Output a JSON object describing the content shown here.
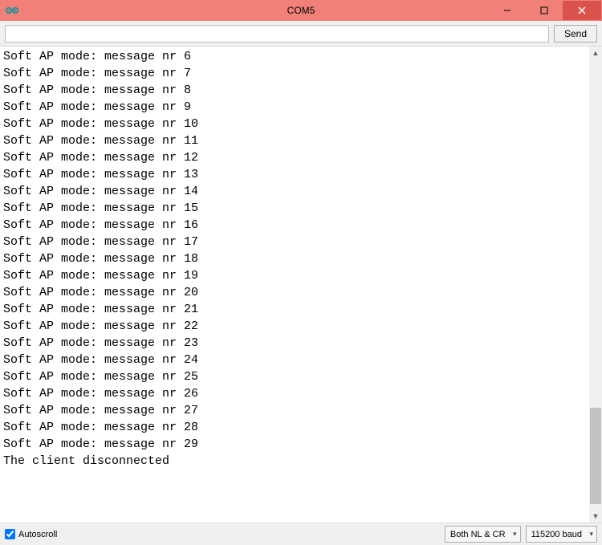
{
  "window": {
    "title": "COM5"
  },
  "toolbar": {
    "input_value": "",
    "send_label": "Send"
  },
  "console": {
    "lines": [
      "Soft AP mode: message nr 6",
      "Soft AP mode: message nr 7",
      "Soft AP mode: message nr 8",
      "Soft AP mode: message nr 9",
      "Soft AP mode: message nr 10",
      "Soft AP mode: message nr 11",
      "Soft AP mode: message nr 12",
      "Soft AP mode: message nr 13",
      "Soft AP mode: message nr 14",
      "Soft AP mode: message nr 15",
      "Soft AP mode: message nr 16",
      "Soft AP mode: message nr 17",
      "Soft AP mode: message nr 18",
      "Soft AP mode: message nr 19",
      "Soft AP mode: message nr 20",
      "Soft AP mode: message nr 21",
      "Soft AP mode: message nr 22",
      "Soft AP mode: message nr 23",
      "Soft AP mode: message nr 24",
      "Soft AP mode: message nr 25",
      "Soft AP mode: message nr 26",
      "Soft AP mode: message nr 27",
      "Soft AP mode: message nr 28",
      "Soft AP mode: message nr 29",
      "The client disconnected"
    ]
  },
  "statusbar": {
    "autoscroll_label": "Autoscroll",
    "autoscroll_checked": true,
    "line_ending": "Both NL & CR",
    "baud": "115200 baud"
  }
}
